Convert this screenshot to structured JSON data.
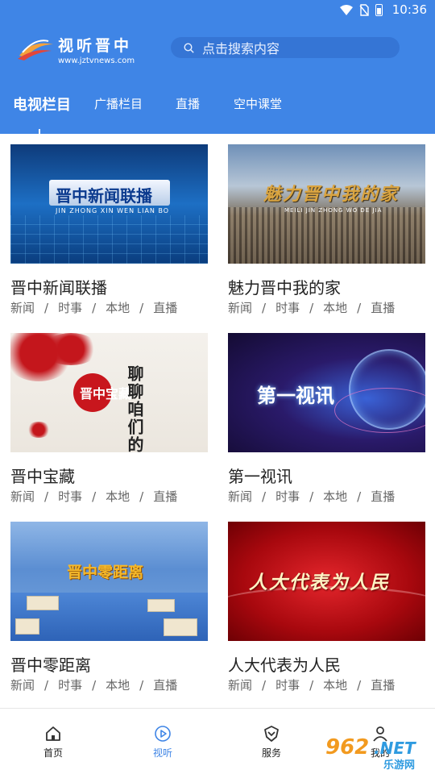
{
  "status_bar": {
    "time": "10:36"
  },
  "header": {
    "logo_name": "视听晋中",
    "logo_url": "www.jztvnews.com",
    "search_placeholder": "点击搜索内容"
  },
  "tabs": [
    {
      "label": "电视栏目",
      "active": true
    },
    {
      "label": "广播栏目",
      "active": false
    },
    {
      "label": "直播",
      "active": false
    },
    {
      "label": "空中课堂",
      "active": false
    }
  ],
  "programs": [
    {
      "title": "晋中新闻联播",
      "thumb_title": "晋中新闻联播",
      "thumb_sub": "JIN ZHONG XIN WEN LIAN BO",
      "tags": [
        "新闻",
        "时事",
        "本地",
        "直播"
      ]
    },
    {
      "title": "魅力晋中我的家",
      "thumb_title": "魅力晋中我的家",
      "thumb_sub": "MEILI JIN ZHONG WO DE JIA",
      "tags": [
        "新闻",
        "时事",
        "本地",
        "直播"
      ]
    },
    {
      "title": "晋中宝藏",
      "thumb_title": "聊聊咱们的文物",
      "thumb_sub": "晋中宝藏",
      "tags": [
        "新闻",
        "时事",
        "本地",
        "直播"
      ]
    },
    {
      "title": "第一视讯",
      "thumb_title": "第一视讯",
      "thumb_sub": "",
      "tags": [
        "新闻",
        "时事",
        "本地",
        "直播"
      ]
    },
    {
      "title": "晋中零距离",
      "thumb_title": "晋中零距离",
      "thumb_sub": "",
      "tags": [
        "新闻",
        "时事",
        "本地",
        "直播"
      ]
    },
    {
      "title": "人大代表为人民",
      "thumb_title": "人大代表为人民",
      "thumb_sub": "",
      "tags": [
        "新闻",
        "时事",
        "本地",
        "直播"
      ]
    }
  ],
  "bottom_nav": [
    {
      "label": "首页",
      "icon": "home-icon",
      "active": false
    },
    {
      "label": "视听",
      "icon": "play-icon",
      "active": true
    },
    {
      "label": "服务",
      "icon": "service-icon",
      "active": false
    },
    {
      "label": "我的",
      "icon": "user-icon",
      "active": false
    }
  ],
  "watermark": {
    "num": "962",
    "net": ".NET",
    "sub": "乐游网"
  },
  "colors": {
    "brand_blue": "#3f85e6",
    "active_nav": "#3f85e6"
  }
}
